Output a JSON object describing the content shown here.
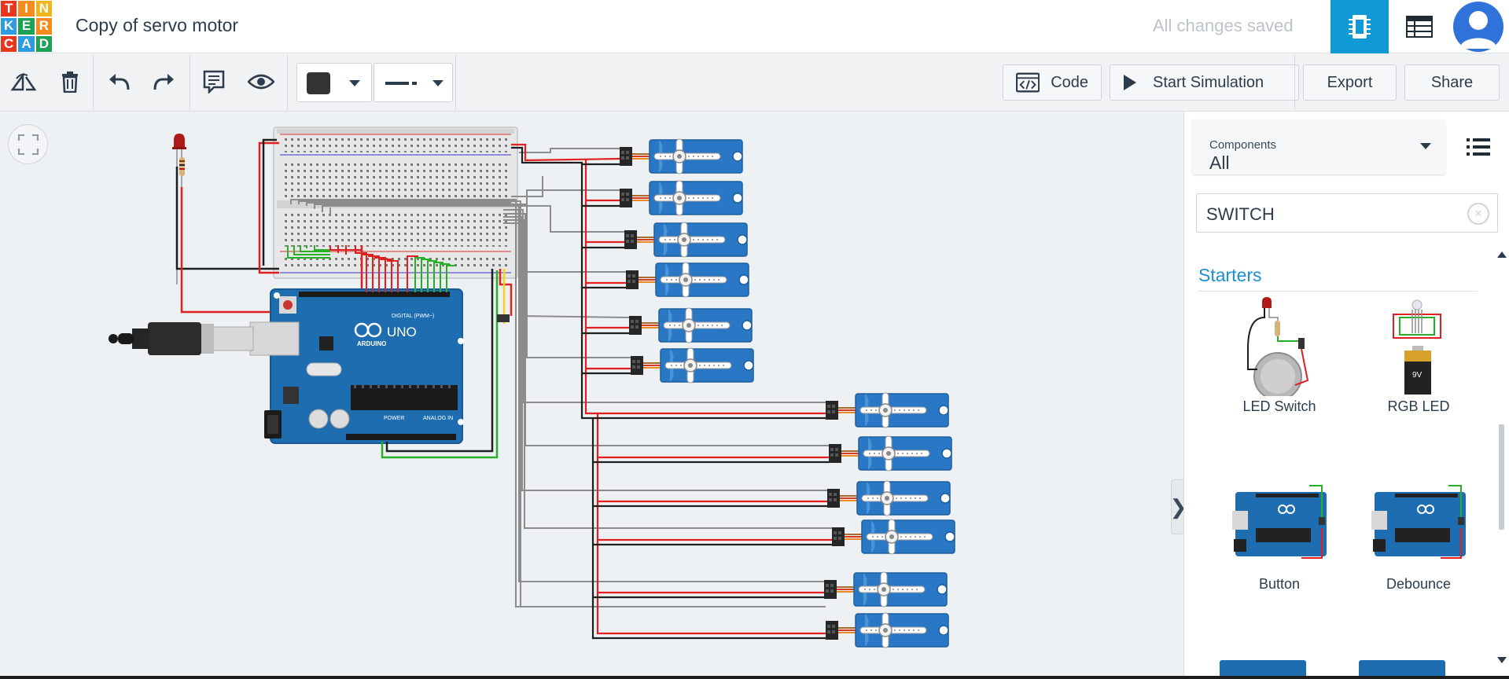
{
  "app": {
    "logo_letters": [
      "T",
      "I",
      "N",
      "K",
      "E",
      "R",
      "C",
      "A",
      "D"
    ],
    "logo_colors": [
      "#e8361f",
      "#f48b1c",
      "#f0b41d",
      "#2f9be0",
      "#1ba255",
      "#f48b1c",
      "#e8361f",
      "#2f9be0",
      "#1ba255"
    ],
    "project_title": "Copy of servo motor",
    "save_status": "All changes saved",
    "accent_color": "#0f9ad6"
  },
  "toolbar": {
    "rotate_icon": "rotate-icon",
    "delete_icon": "trash-icon",
    "undo_icon": "undo-icon",
    "redo_icon": "redo-icon",
    "notes_icon": "notes-icon",
    "visibility_icon": "eye-icon",
    "color_swatch": "#333333",
    "code_label": "Code",
    "simulate_label": "Start Simulation",
    "export_label": "Export",
    "share_label": "Share"
  },
  "panel": {
    "components_label": "Components",
    "components_value": "All",
    "search_value": "SWITCH",
    "section_title": "Starters",
    "starters": [
      {
        "label": "LED Switch"
      },
      {
        "label": "RGB LED"
      },
      {
        "label": "Button"
      },
      {
        "label": "Debounce"
      }
    ]
  },
  "circuit": {
    "arduino_label": "UNO",
    "arduino_brand": "ARDUINO",
    "digital_label": "DIGITAL (PWM~)",
    "power_label": "POWER",
    "analog_label": "ANALOG IN",
    "battery_label": "9V",
    "servo_count": 12,
    "wire_colors": {
      "signal": "#8c8c8c",
      "power": "#e02020",
      "ground": "#1e1e1e",
      "data": "#27b025"
    }
  }
}
